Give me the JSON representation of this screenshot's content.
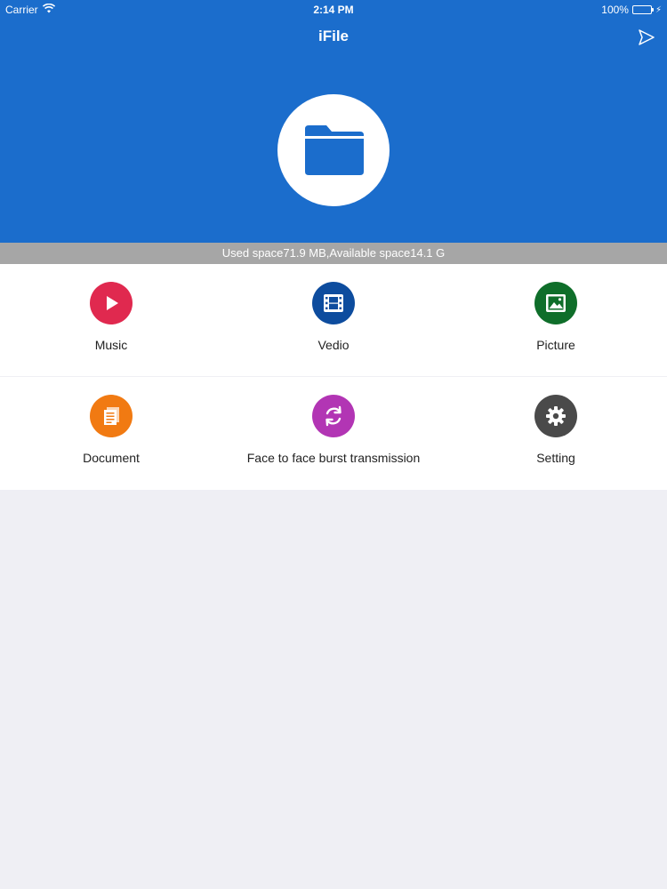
{
  "status_bar": {
    "carrier": "Carrier",
    "time": "2:14 PM",
    "battery": "100%"
  },
  "header": {
    "title": "iFile",
    "background_color": "#1b6dcc",
    "hero_icon": "folder-icon",
    "send_icon": "send-icon"
  },
  "storage": {
    "text": "Used space71.9 MB,Available space14.1 G"
  },
  "tiles": [
    {
      "label": "Music",
      "icon": "play-icon",
      "color": "#e0294f"
    },
    {
      "label": "Vedio",
      "icon": "film-icon",
      "color": "#0d4c9e"
    },
    {
      "label": "Picture",
      "icon": "image-icon",
      "color": "#0f6e2a"
    },
    {
      "label": "Document",
      "icon": "document-icon",
      "color": "#f17a12"
    },
    {
      "label": "Face to face burst transmission",
      "icon": "sync-icon",
      "color": "#b235b4"
    },
    {
      "label": "Setting",
      "icon": "gear-icon",
      "color": "#4a4a4a"
    }
  ]
}
